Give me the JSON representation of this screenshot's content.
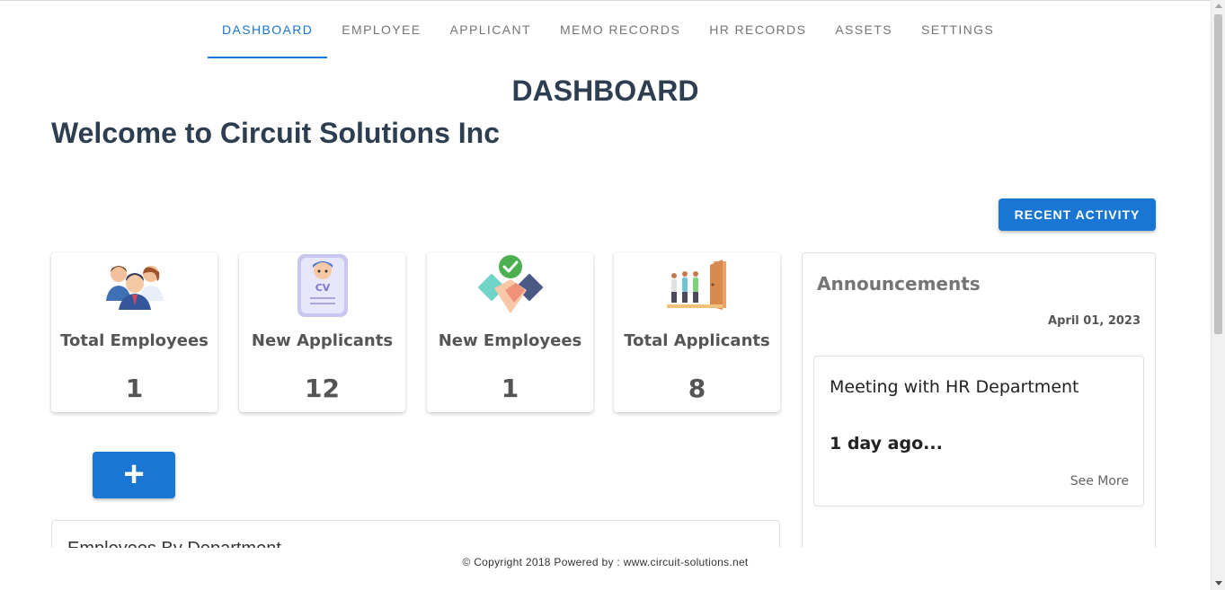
{
  "nav": {
    "tabs": [
      {
        "label": "DASHBOARD",
        "active": true
      },
      {
        "label": "EMPLOYEE",
        "active": false
      },
      {
        "label": "APPLICANT",
        "active": false
      },
      {
        "label": "MEMO RECORDS",
        "active": false
      },
      {
        "label": "HR RECORDS",
        "active": false
      },
      {
        "label": "ASSETS",
        "active": false
      },
      {
        "label": "SETTINGS",
        "active": false
      }
    ]
  },
  "page": {
    "title": "DASHBOARD",
    "welcome": "Welcome to Circuit Solutions Inc"
  },
  "actions": {
    "recent_activity_label": "RECENT ACTIVITY",
    "add_label": "+"
  },
  "stats": [
    {
      "label": "Total Employees",
      "value": "1",
      "icon": "employees-group-icon"
    },
    {
      "label": "New Applicants",
      "value": "12",
      "icon": "cv-document-icon"
    },
    {
      "label": "New Employees",
      "value": "1",
      "icon": "handshake-icon"
    },
    {
      "label": "Total Applicants",
      "value": "8",
      "icon": "waiting-room-icon"
    }
  ],
  "department_section": {
    "title": "Employees By Department"
  },
  "announcements": {
    "title": "Announcements",
    "date": "April 01, 2023",
    "items": [
      {
        "title": "Meeting with HR Department",
        "time": "1 day ago...",
        "see_more": "See More"
      }
    ]
  },
  "footer": {
    "text": "© Copyright 2018 Powered by : www.circuit-solutions.net"
  },
  "colors": {
    "primary": "#1976d2",
    "heading": "#2c3e50"
  }
}
